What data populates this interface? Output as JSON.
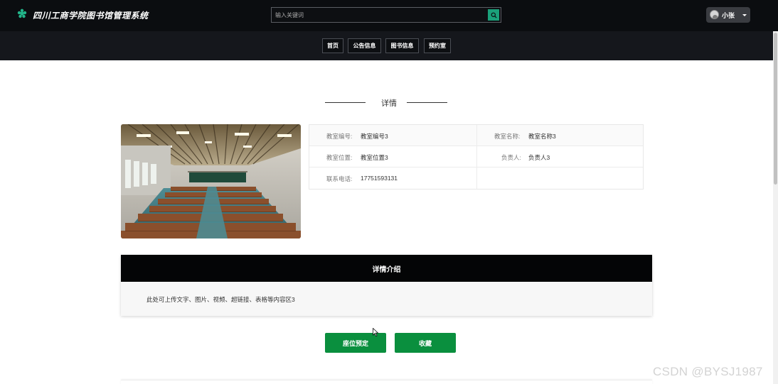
{
  "header": {
    "site_title": "四川工商学院图书馆管理系统",
    "search": {
      "placeholder": "输入关键词",
      "value": ""
    },
    "user": {
      "name": "小张"
    }
  },
  "nav": {
    "items": [
      {
        "label": "首页"
      },
      {
        "label": "公告信息"
      },
      {
        "label": "图书信息"
      },
      {
        "label": "预约室"
      }
    ]
  },
  "section": {
    "title": "详情"
  },
  "details": {
    "room_no_label": "教室编号:",
    "room_no": "教室编号3",
    "room_name_label": "教室名称:",
    "room_name": "教室名称3",
    "room_loc_label": "教室位置:",
    "room_loc": "教室位置3",
    "owner_label": "负责人:",
    "owner": "负责人3",
    "phone_label": "联系电话:",
    "phone": "17751593131"
  },
  "description": {
    "heading": "详情介绍",
    "body": "此处可上传文字、图片、视频、超链接、表格等内容区3"
  },
  "actions": {
    "reserve_label": "座位预定",
    "favorite_label": "收藏"
  },
  "watermark": "CSDN @BYSJ1987",
  "colors": {
    "accent_green": "#0a8f3e",
    "search_green": "#1aa17a",
    "header_bg": "#0b0d10"
  }
}
